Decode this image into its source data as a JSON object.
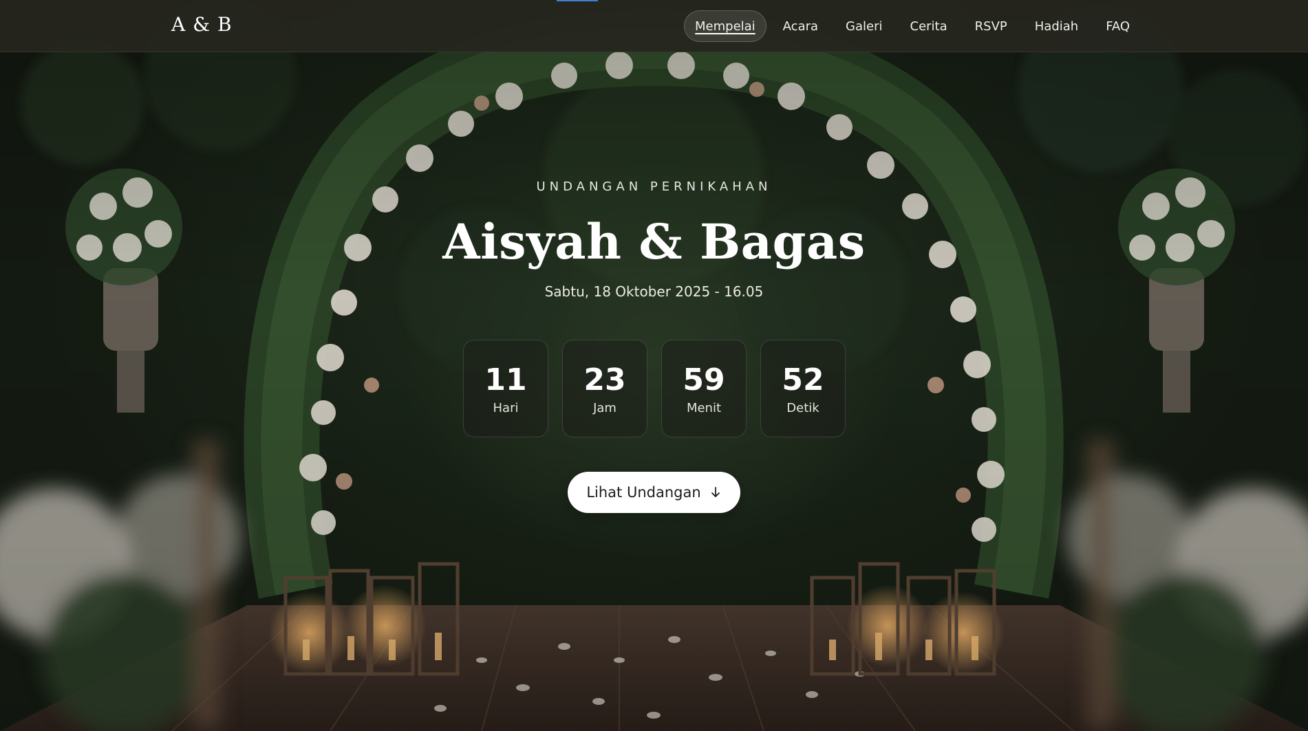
{
  "nav": {
    "logo": "A & B",
    "links": [
      {
        "label": "Mempelai"
      },
      {
        "label": "Acara"
      },
      {
        "label": "Galeri"
      },
      {
        "label": "Cerita"
      },
      {
        "label": "RSVP"
      },
      {
        "label": "Hadiah"
      },
      {
        "label": "FAQ"
      }
    ],
    "active_index": 0
  },
  "hero": {
    "kicker": "UNDANGAN PERNIKAHAN",
    "couple": "Aisyah & Bagas",
    "date": "Sabtu, 18 Oktober 2025 - 16.05",
    "countdown": [
      {
        "value": "11",
        "label": "Hari"
      },
      {
        "value": "23",
        "label": "Jam"
      },
      {
        "value": "59",
        "label": "Menit"
      },
      {
        "value": "52",
        "label": "Detik"
      }
    ],
    "cta_label": "Lihat Undangan",
    "cta_icon": "arrow-down-icon"
  },
  "colors": {
    "nav_bg": "#26261e",
    "nav_accent": "#3f7fd6",
    "cta_bg": "#ffffff",
    "text_light": "#ffffff"
  }
}
